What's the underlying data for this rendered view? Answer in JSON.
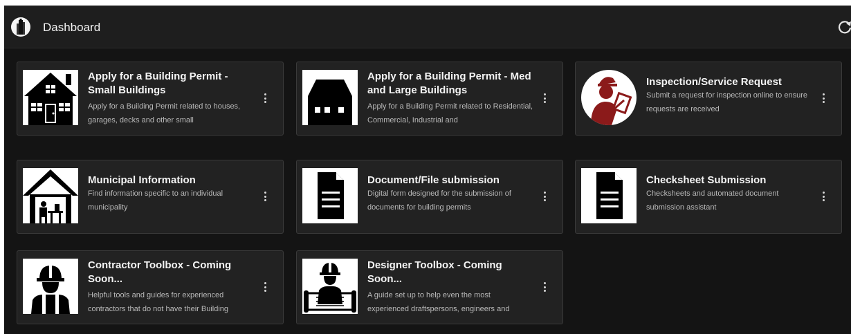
{
  "header": {
    "title": "Dashboard",
    "logo_icon": "building-tower-logo",
    "refresh_icon": "refresh-icon"
  },
  "cards": [
    {
      "title": "Apply for a Building Permit - Small Buildings",
      "description": "Apply for a Building Permit related to houses, garages, decks and other small",
      "icon": "house-icon"
    },
    {
      "title": "Apply for a Building Permit - Med and Large Buildings",
      "description": "Apply for a Building Permit related to Residential, Commercial, Industrial and",
      "icon": "large-building-icon"
    },
    {
      "title": "Inspection/Service Request",
      "description": "Submit a request for inspection online to ensure requests are received",
      "icon": "inspector-icon"
    },
    {
      "title": "Municipal Information",
      "description": "Find information specific to an individual municipality",
      "icon": "municipal-office-icon"
    },
    {
      "title": "Document/File submission",
      "description": "Digital form designed for the submission of documents for building permits",
      "icon": "document-icon"
    },
    {
      "title": "Checksheet Submission",
      "description": "Checksheets and automated document submission assistant",
      "icon": "document-icon"
    },
    {
      "title": "Contractor Toolbox - Coming Soon...",
      "description": "Helpful tools and guides for experienced contractors that do not have their Building",
      "icon": "contractor-icon"
    },
    {
      "title": "Designer Toolbox - Coming Soon...",
      "description": "A guide set up to help even the most experienced draftspersons, engineers and",
      "icon": "designer-icon"
    }
  ],
  "colors": {
    "background": "#141414",
    "card": "#222222",
    "inspector_accent": "#8b1a1a"
  }
}
